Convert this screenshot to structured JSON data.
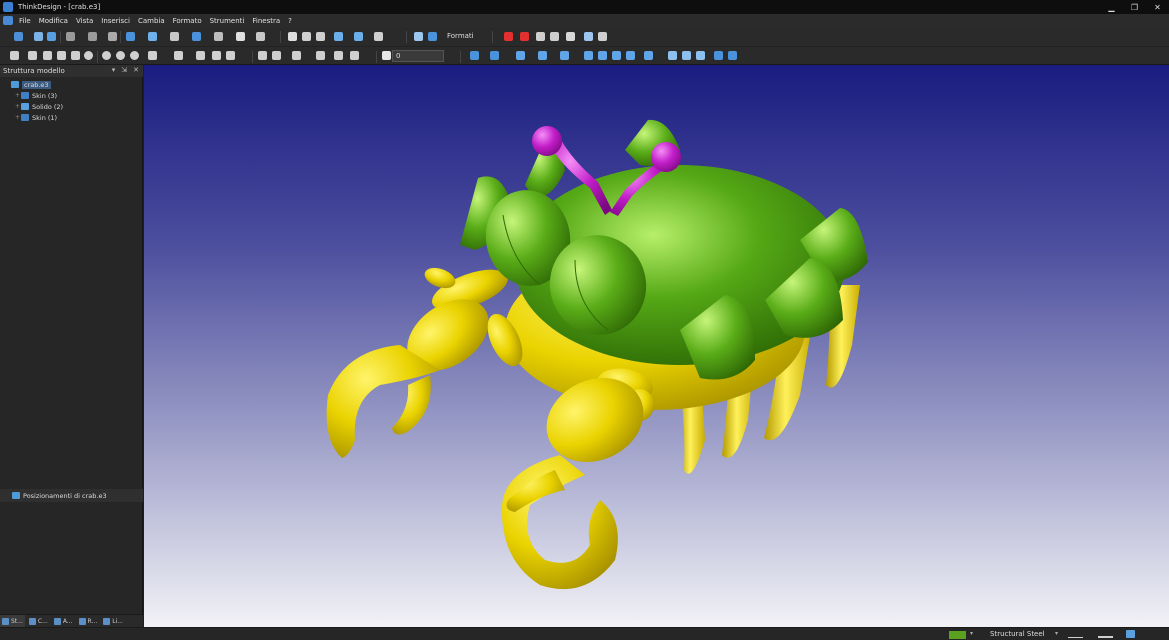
{
  "window": {
    "title": "ThinkDesign - [crab.e3]",
    "minimize": "▁",
    "restore": "❐",
    "close": "✕"
  },
  "menu": [
    "File",
    "Modifica",
    "Vista",
    "Inserisci",
    "Cambia",
    "Formato",
    "Strumenti",
    "Finestra",
    "?"
  ],
  "toolbar": {
    "styles_label": "Formati",
    "layer_value": "0"
  },
  "model_panel": {
    "title": "Struttura modello",
    "controls": [
      "▾",
      "⇲",
      "✕"
    ],
    "tree": [
      {
        "label": "crab.e3",
        "expander": "",
        "icon_color": "#4f9bd8"
      },
      {
        "label": "Skin (3)",
        "expander": "+",
        "icon_color": "#3f7fc4"
      },
      {
        "label": "Solido (2)",
        "expander": "+",
        "icon_color": "#5aa0de"
      },
      {
        "label": "Skin (1)",
        "expander": "+",
        "icon_color": "#3f7fc4"
      }
    ]
  },
  "positions_panel": {
    "title": "Posizionamenti di crab.e3"
  },
  "bottom_tabs": [
    "St...",
    "C...",
    "A...",
    "R...",
    "Li..."
  ],
  "viewport": {
    "model": "crab",
    "colors": {
      "body": "#4f9e12",
      "highlight": "#b7ef6a",
      "legs": "#e6cf00",
      "leg_highlight": "#fff46a",
      "antennae": "#c21ec9",
      "background_top": "#1a1c80",
      "background_bottom": "#f2f2f6"
    }
  },
  "status": {
    "material": "Structural Steel",
    "material_color": "#5aa021"
  }
}
